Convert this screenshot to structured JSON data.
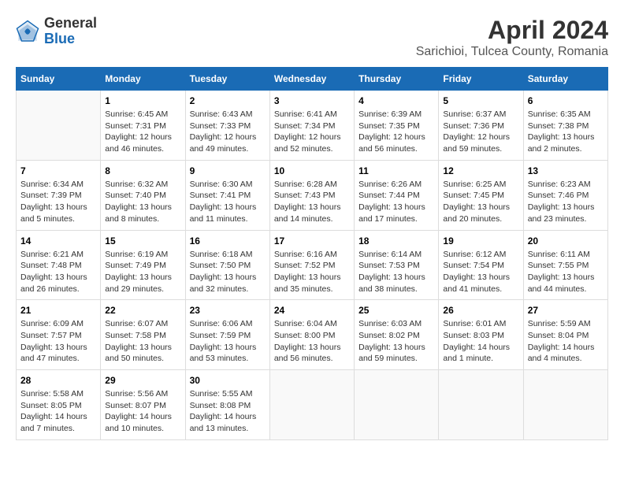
{
  "header": {
    "logo_line1": "General",
    "logo_line2": "Blue",
    "title": "April 2024",
    "subtitle": "Sarichioi, Tulcea County, Romania"
  },
  "days_of_week": [
    "Sunday",
    "Monday",
    "Tuesday",
    "Wednesday",
    "Thursday",
    "Friday",
    "Saturday"
  ],
  "weeks": [
    [
      {
        "day": "",
        "info": ""
      },
      {
        "day": "1",
        "info": "Sunrise: 6:45 AM\nSunset: 7:31 PM\nDaylight: 12 hours\nand 46 minutes."
      },
      {
        "day": "2",
        "info": "Sunrise: 6:43 AM\nSunset: 7:33 PM\nDaylight: 12 hours\nand 49 minutes."
      },
      {
        "day": "3",
        "info": "Sunrise: 6:41 AM\nSunset: 7:34 PM\nDaylight: 12 hours\nand 52 minutes."
      },
      {
        "day": "4",
        "info": "Sunrise: 6:39 AM\nSunset: 7:35 PM\nDaylight: 12 hours\nand 56 minutes."
      },
      {
        "day": "5",
        "info": "Sunrise: 6:37 AM\nSunset: 7:36 PM\nDaylight: 12 hours\nand 59 minutes."
      },
      {
        "day": "6",
        "info": "Sunrise: 6:35 AM\nSunset: 7:38 PM\nDaylight: 13 hours\nand 2 minutes."
      }
    ],
    [
      {
        "day": "7",
        "info": "Sunrise: 6:34 AM\nSunset: 7:39 PM\nDaylight: 13 hours\nand 5 minutes."
      },
      {
        "day": "8",
        "info": "Sunrise: 6:32 AM\nSunset: 7:40 PM\nDaylight: 13 hours\nand 8 minutes."
      },
      {
        "day": "9",
        "info": "Sunrise: 6:30 AM\nSunset: 7:41 PM\nDaylight: 13 hours\nand 11 minutes."
      },
      {
        "day": "10",
        "info": "Sunrise: 6:28 AM\nSunset: 7:43 PM\nDaylight: 13 hours\nand 14 minutes."
      },
      {
        "day": "11",
        "info": "Sunrise: 6:26 AM\nSunset: 7:44 PM\nDaylight: 13 hours\nand 17 minutes."
      },
      {
        "day": "12",
        "info": "Sunrise: 6:25 AM\nSunset: 7:45 PM\nDaylight: 13 hours\nand 20 minutes."
      },
      {
        "day": "13",
        "info": "Sunrise: 6:23 AM\nSunset: 7:46 PM\nDaylight: 13 hours\nand 23 minutes."
      }
    ],
    [
      {
        "day": "14",
        "info": "Sunrise: 6:21 AM\nSunset: 7:48 PM\nDaylight: 13 hours\nand 26 minutes."
      },
      {
        "day": "15",
        "info": "Sunrise: 6:19 AM\nSunset: 7:49 PM\nDaylight: 13 hours\nand 29 minutes."
      },
      {
        "day": "16",
        "info": "Sunrise: 6:18 AM\nSunset: 7:50 PM\nDaylight: 13 hours\nand 32 minutes."
      },
      {
        "day": "17",
        "info": "Sunrise: 6:16 AM\nSunset: 7:52 PM\nDaylight: 13 hours\nand 35 minutes."
      },
      {
        "day": "18",
        "info": "Sunrise: 6:14 AM\nSunset: 7:53 PM\nDaylight: 13 hours\nand 38 minutes."
      },
      {
        "day": "19",
        "info": "Sunrise: 6:12 AM\nSunset: 7:54 PM\nDaylight: 13 hours\nand 41 minutes."
      },
      {
        "day": "20",
        "info": "Sunrise: 6:11 AM\nSunset: 7:55 PM\nDaylight: 13 hours\nand 44 minutes."
      }
    ],
    [
      {
        "day": "21",
        "info": "Sunrise: 6:09 AM\nSunset: 7:57 PM\nDaylight: 13 hours\nand 47 minutes."
      },
      {
        "day": "22",
        "info": "Sunrise: 6:07 AM\nSunset: 7:58 PM\nDaylight: 13 hours\nand 50 minutes."
      },
      {
        "day": "23",
        "info": "Sunrise: 6:06 AM\nSunset: 7:59 PM\nDaylight: 13 hours\nand 53 minutes."
      },
      {
        "day": "24",
        "info": "Sunrise: 6:04 AM\nSunset: 8:00 PM\nDaylight: 13 hours\nand 56 minutes."
      },
      {
        "day": "25",
        "info": "Sunrise: 6:03 AM\nSunset: 8:02 PM\nDaylight: 13 hours\nand 59 minutes."
      },
      {
        "day": "26",
        "info": "Sunrise: 6:01 AM\nSunset: 8:03 PM\nDaylight: 14 hours\nand 1 minute."
      },
      {
        "day": "27",
        "info": "Sunrise: 5:59 AM\nSunset: 8:04 PM\nDaylight: 14 hours\nand 4 minutes."
      }
    ],
    [
      {
        "day": "28",
        "info": "Sunrise: 5:58 AM\nSunset: 8:05 PM\nDaylight: 14 hours\nand 7 minutes."
      },
      {
        "day": "29",
        "info": "Sunrise: 5:56 AM\nSunset: 8:07 PM\nDaylight: 14 hours\nand 10 minutes."
      },
      {
        "day": "30",
        "info": "Sunrise: 5:55 AM\nSunset: 8:08 PM\nDaylight: 14 hours\nand 13 minutes."
      },
      {
        "day": "",
        "info": ""
      },
      {
        "day": "",
        "info": ""
      },
      {
        "day": "",
        "info": ""
      },
      {
        "day": "",
        "info": ""
      }
    ]
  ]
}
